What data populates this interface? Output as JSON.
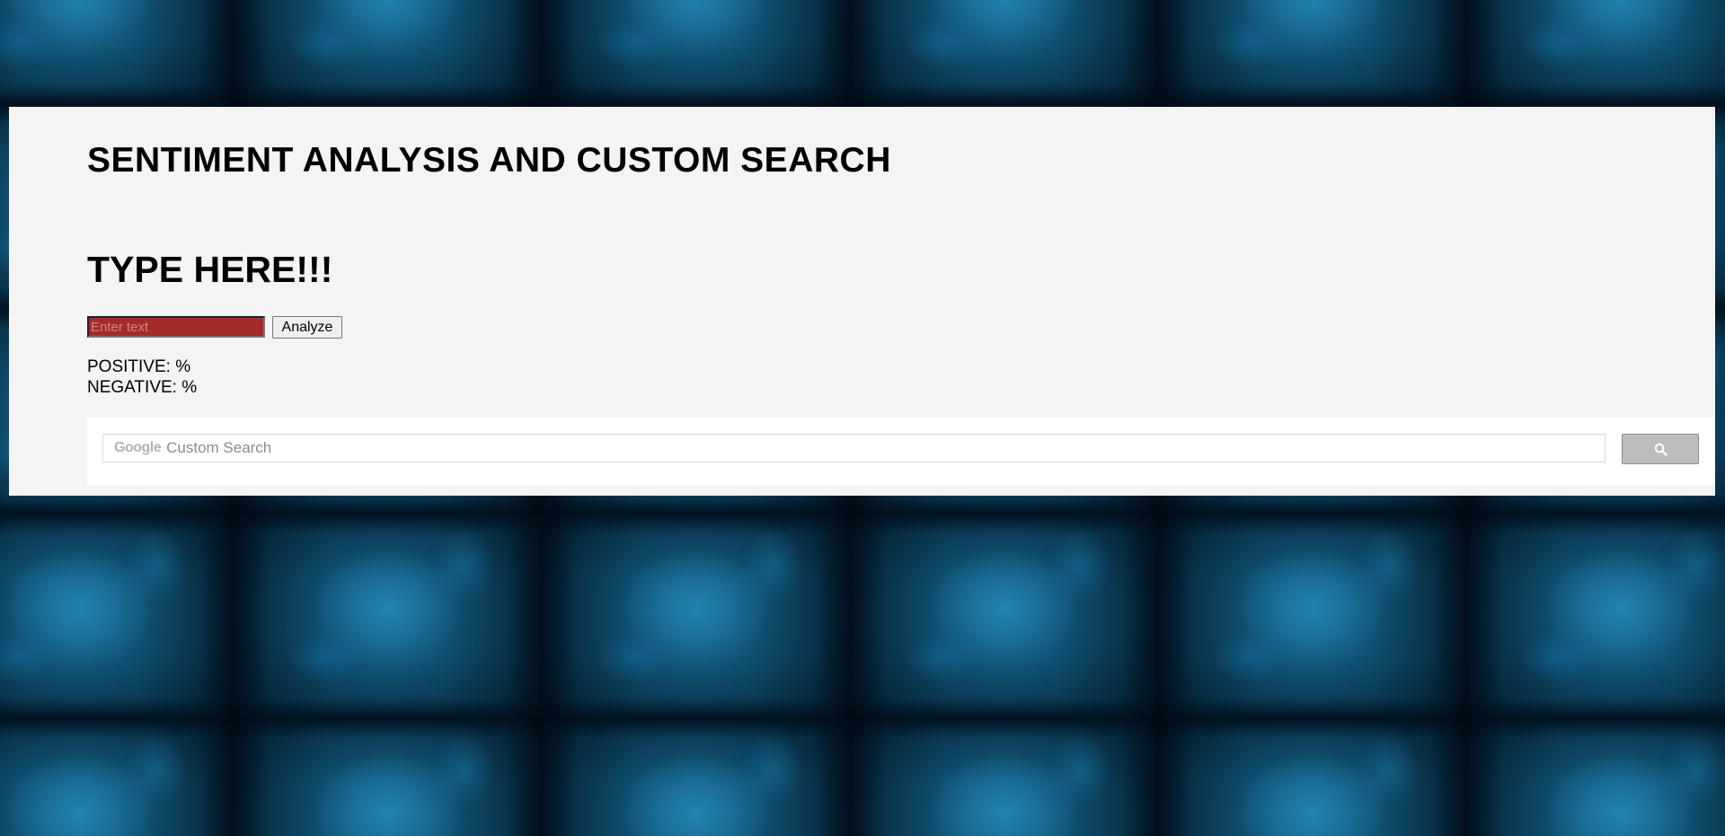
{
  "header": {
    "title": "SENTIMENT ANALYSIS AND CUSTOM SEARCH",
    "prompt": "TYPE HERE!!!"
  },
  "analyzer": {
    "input_placeholder": "Enter text",
    "input_value": "",
    "button_label": "Analyze",
    "positive_label": "POSITIVE: %",
    "negative_label": "NEGATIVE: %"
  },
  "custom_search": {
    "brand": "Google",
    "placeholder": "Custom Search",
    "button_icon": "search-icon"
  },
  "colors": {
    "panel_background": "#f4f4f4",
    "input_background": "#a52a2a",
    "page_background": "#0b3a52"
  }
}
